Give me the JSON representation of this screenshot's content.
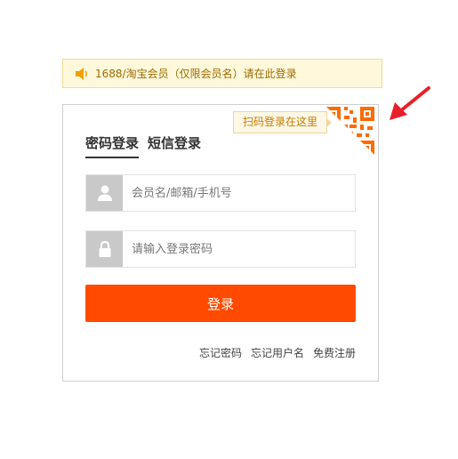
{
  "notice": {
    "icon": "speaker-icon",
    "text": "1688/淘宝会员（仅限会员名）请在此登录"
  },
  "qr": {
    "tip": "扫码登录在这里",
    "icon": "qr-code-icon"
  },
  "tabs": [
    {
      "label": "密码登录",
      "active": true
    },
    {
      "label": "短信登录",
      "active": false
    }
  ],
  "form": {
    "username": {
      "placeholder": "会员名/邮箱/手机号",
      "value": "",
      "icon": "user-icon"
    },
    "password": {
      "placeholder": "请输入登录密码",
      "value": "",
      "icon": "lock-icon"
    },
    "submit_label": "登录"
  },
  "links": [
    {
      "label": "忘记密码"
    },
    {
      "label": "忘记用户名"
    },
    {
      "label": "免费注册"
    }
  ],
  "colors": {
    "accent": "#ff4a00",
    "notice_bg": "#fff8db",
    "notice_border": "#f0dc94",
    "arrow": "#e8202a",
    "icon_box": "#c9c9c9"
  }
}
